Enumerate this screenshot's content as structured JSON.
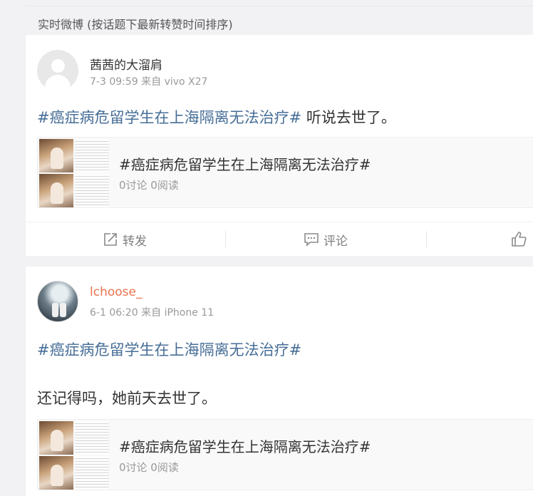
{
  "section": {
    "title": "实时微博 (按话题下最新转赞时间排序)"
  },
  "posts": [
    {
      "user": "茜茜的大溜肩",
      "time": "7-3 09:59",
      "from_word": "来自",
      "device": "vivo X27",
      "topic": "#癌症病危留学生在上海隔离无法治疗#",
      "text_after": " 听说去世了。",
      "link_card": {
        "title": "#癌症病危留学生在上海隔离无法治疗#",
        "stats": "0讨论 0阅读"
      },
      "actions": {
        "repost": "转发",
        "comment": "评论"
      }
    },
    {
      "user": "lchoose_",
      "time": "6-1 06:20",
      "from_word": "来自",
      "device": "iPhone 11",
      "topic": "#癌症病危留学生在上海隔离无法治疗#",
      "text_line2": "还记得吗，她前天去世了。",
      "link_card": {
        "title": "#癌症病危留学生在上海隔离无法治疗#",
        "stats": "0讨论 0阅读"
      }
    }
  ],
  "icons": [
    "repost-icon",
    "comment-icon",
    "like-icon",
    "default-avatar-icon"
  ],
  "colors": {
    "topic": "#476e97",
    "username_highlight": "#eb7350",
    "meta": "#999999"
  }
}
